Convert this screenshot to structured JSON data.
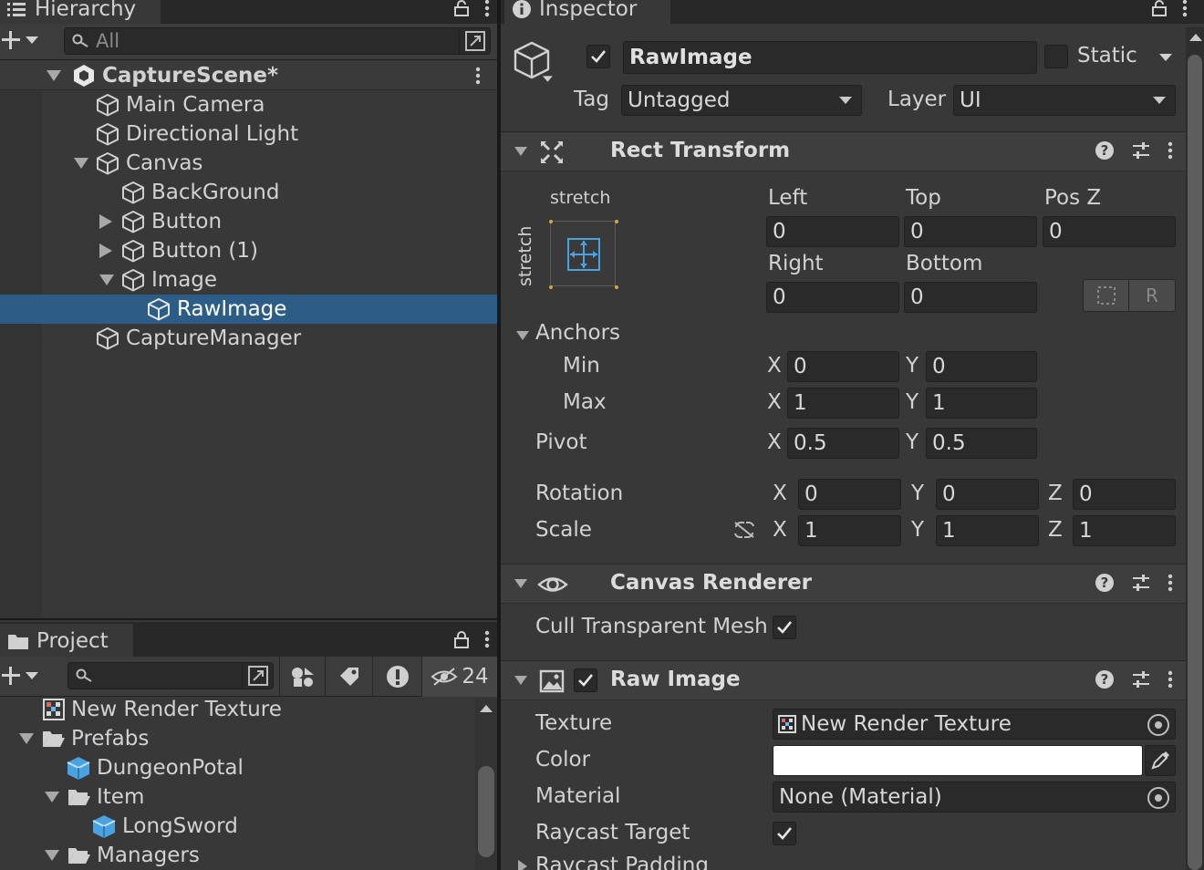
{
  "hierarchy": {
    "tab_label": "Hierarchy",
    "search_placeholder": "All",
    "scene_name": "CaptureScene*",
    "items": [
      {
        "label": "Main Camera"
      },
      {
        "label": "Directional Light"
      },
      {
        "label": "Canvas"
      },
      {
        "label": "BackGround"
      },
      {
        "label": "Button"
      },
      {
        "label": "Button (1)"
      },
      {
        "label": "Image"
      },
      {
        "label": "RawImage"
      },
      {
        "label": "CaptureManager"
      }
    ]
  },
  "project": {
    "tab_label": "Project",
    "hidden_count": "24",
    "items": [
      {
        "label": "New Render Texture"
      },
      {
        "label": "Prefabs"
      },
      {
        "label": "DungeonPotal"
      },
      {
        "label": "Item"
      },
      {
        "label": "LongSword"
      },
      {
        "label": "Managers"
      }
    ]
  },
  "inspector": {
    "tab_label": "Inspector",
    "object_name": "RawImage",
    "static_label": "Static",
    "tag_label": "Tag",
    "tag_value": "Untagged",
    "layer_label": "Layer",
    "layer_value": "UI",
    "rect_transform": {
      "title": "Rect Transform",
      "anchor_preset_top": "stretch",
      "anchor_preset_side": "stretch",
      "left_label": "Left",
      "left_value": "0",
      "top_label": "Top",
      "top_value": "0",
      "posz_label": "Pos Z",
      "posz_value": "0",
      "right_label": "Right",
      "right_value": "0",
      "bottom_label": "Bottom",
      "bottom_value": "0",
      "raw_edit_label": "R",
      "anchors_label": "Anchors",
      "min_label": "Min",
      "min_x": "0",
      "min_y": "0",
      "max_label": "Max",
      "max_x": "1",
      "max_y": "1",
      "pivot_label": "Pivot",
      "pivot_x": "0.5",
      "pivot_y": "0.5",
      "rotation_label": "Rotation",
      "rot_x": "0",
      "rot_y": "0",
      "rot_z": "0",
      "scale_label": "Scale",
      "scale_x": "1",
      "scale_y": "1",
      "scale_z": "1",
      "axis_x": "X",
      "axis_y": "Y",
      "axis_z": "Z"
    },
    "canvas_renderer": {
      "title": "Canvas Renderer",
      "cull_label": "Cull Transparent Mesh",
      "cull_checked": true
    },
    "raw_image": {
      "title": "Raw Image",
      "texture_label": "Texture",
      "texture_value": "New Render Texture",
      "color_label": "Color",
      "color_value": "#ffffff",
      "material_label": "Material",
      "material_value": "None (Material)",
      "raycast_target_label": "Raycast Target",
      "raycast_padding_label": "Raycast Padding"
    }
  },
  "colors": {
    "selection": "#2c5d87",
    "panel": "#383838",
    "field": "#2a2a2a",
    "accent_blue": "#4aa3e0"
  }
}
